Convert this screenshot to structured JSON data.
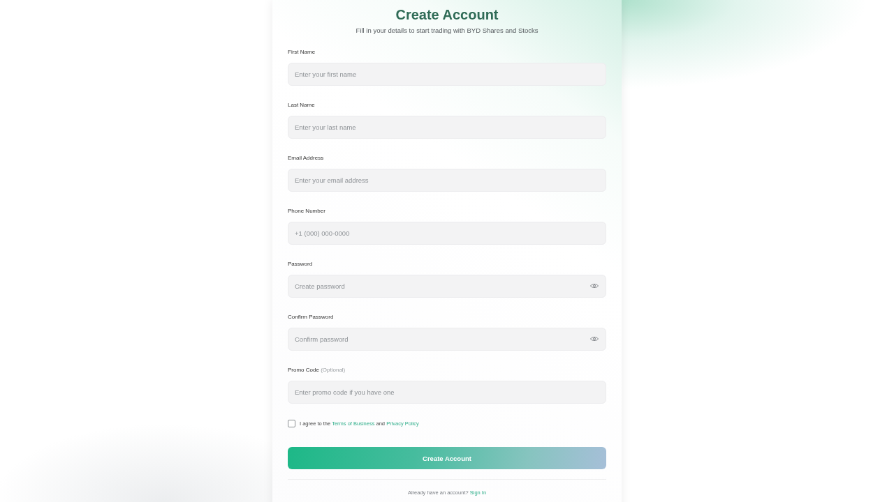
{
  "header": {
    "title": "Create Account",
    "subtitle": "Fill in your details to start trading with BYD Shares and Stocks"
  },
  "fields": [
    {
      "kind": "text",
      "label": "First Name",
      "placeholder": "Enter your first name"
    },
    {
      "kind": "text",
      "label": "Last Name",
      "placeholder": "Enter your last name"
    },
    {
      "kind": "text",
      "label": "Email Address",
      "placeholder": "Enter your email address"
    },
    {
      "kind": "text",
      "label": "Phone Number",
      "placeholder": "+1 (000) 000-0000"
    },
    {
      "kind": "password",
      "label": "Password",
      "placeholder": "Create password"
    },
    {
      "kind": "password",
      "label": "Confirm Password",
      "placeholder": "Confirm password"
    },
    {
      "kind": "text",
      "label": "Promo Code",
      "note": "(Optional)",
      "placeholder": "Enter promo code if you have one"
    }
  ],
  "agreement": {
    "checked": false,
    "parts": [
      {
        "kind": "text",
        "text": "I agree to the"
      },
      {
        "kind": "link",
        "text": "Terms of Business"
      },
      {
        "kind": "text",
        "text": "and"
      },
      {
        "kind": "link",
        "text": "Privacy Policy"
      }
    ]
  },
  "submit_button": "Create Account",
  "footer": {
    "parts": [
      {
        "kind": "text",
        "text": "Already have an account?"
      },
      {
        "kind": "link",
        "text": "Sign In"
      }
    ]
  }
}
